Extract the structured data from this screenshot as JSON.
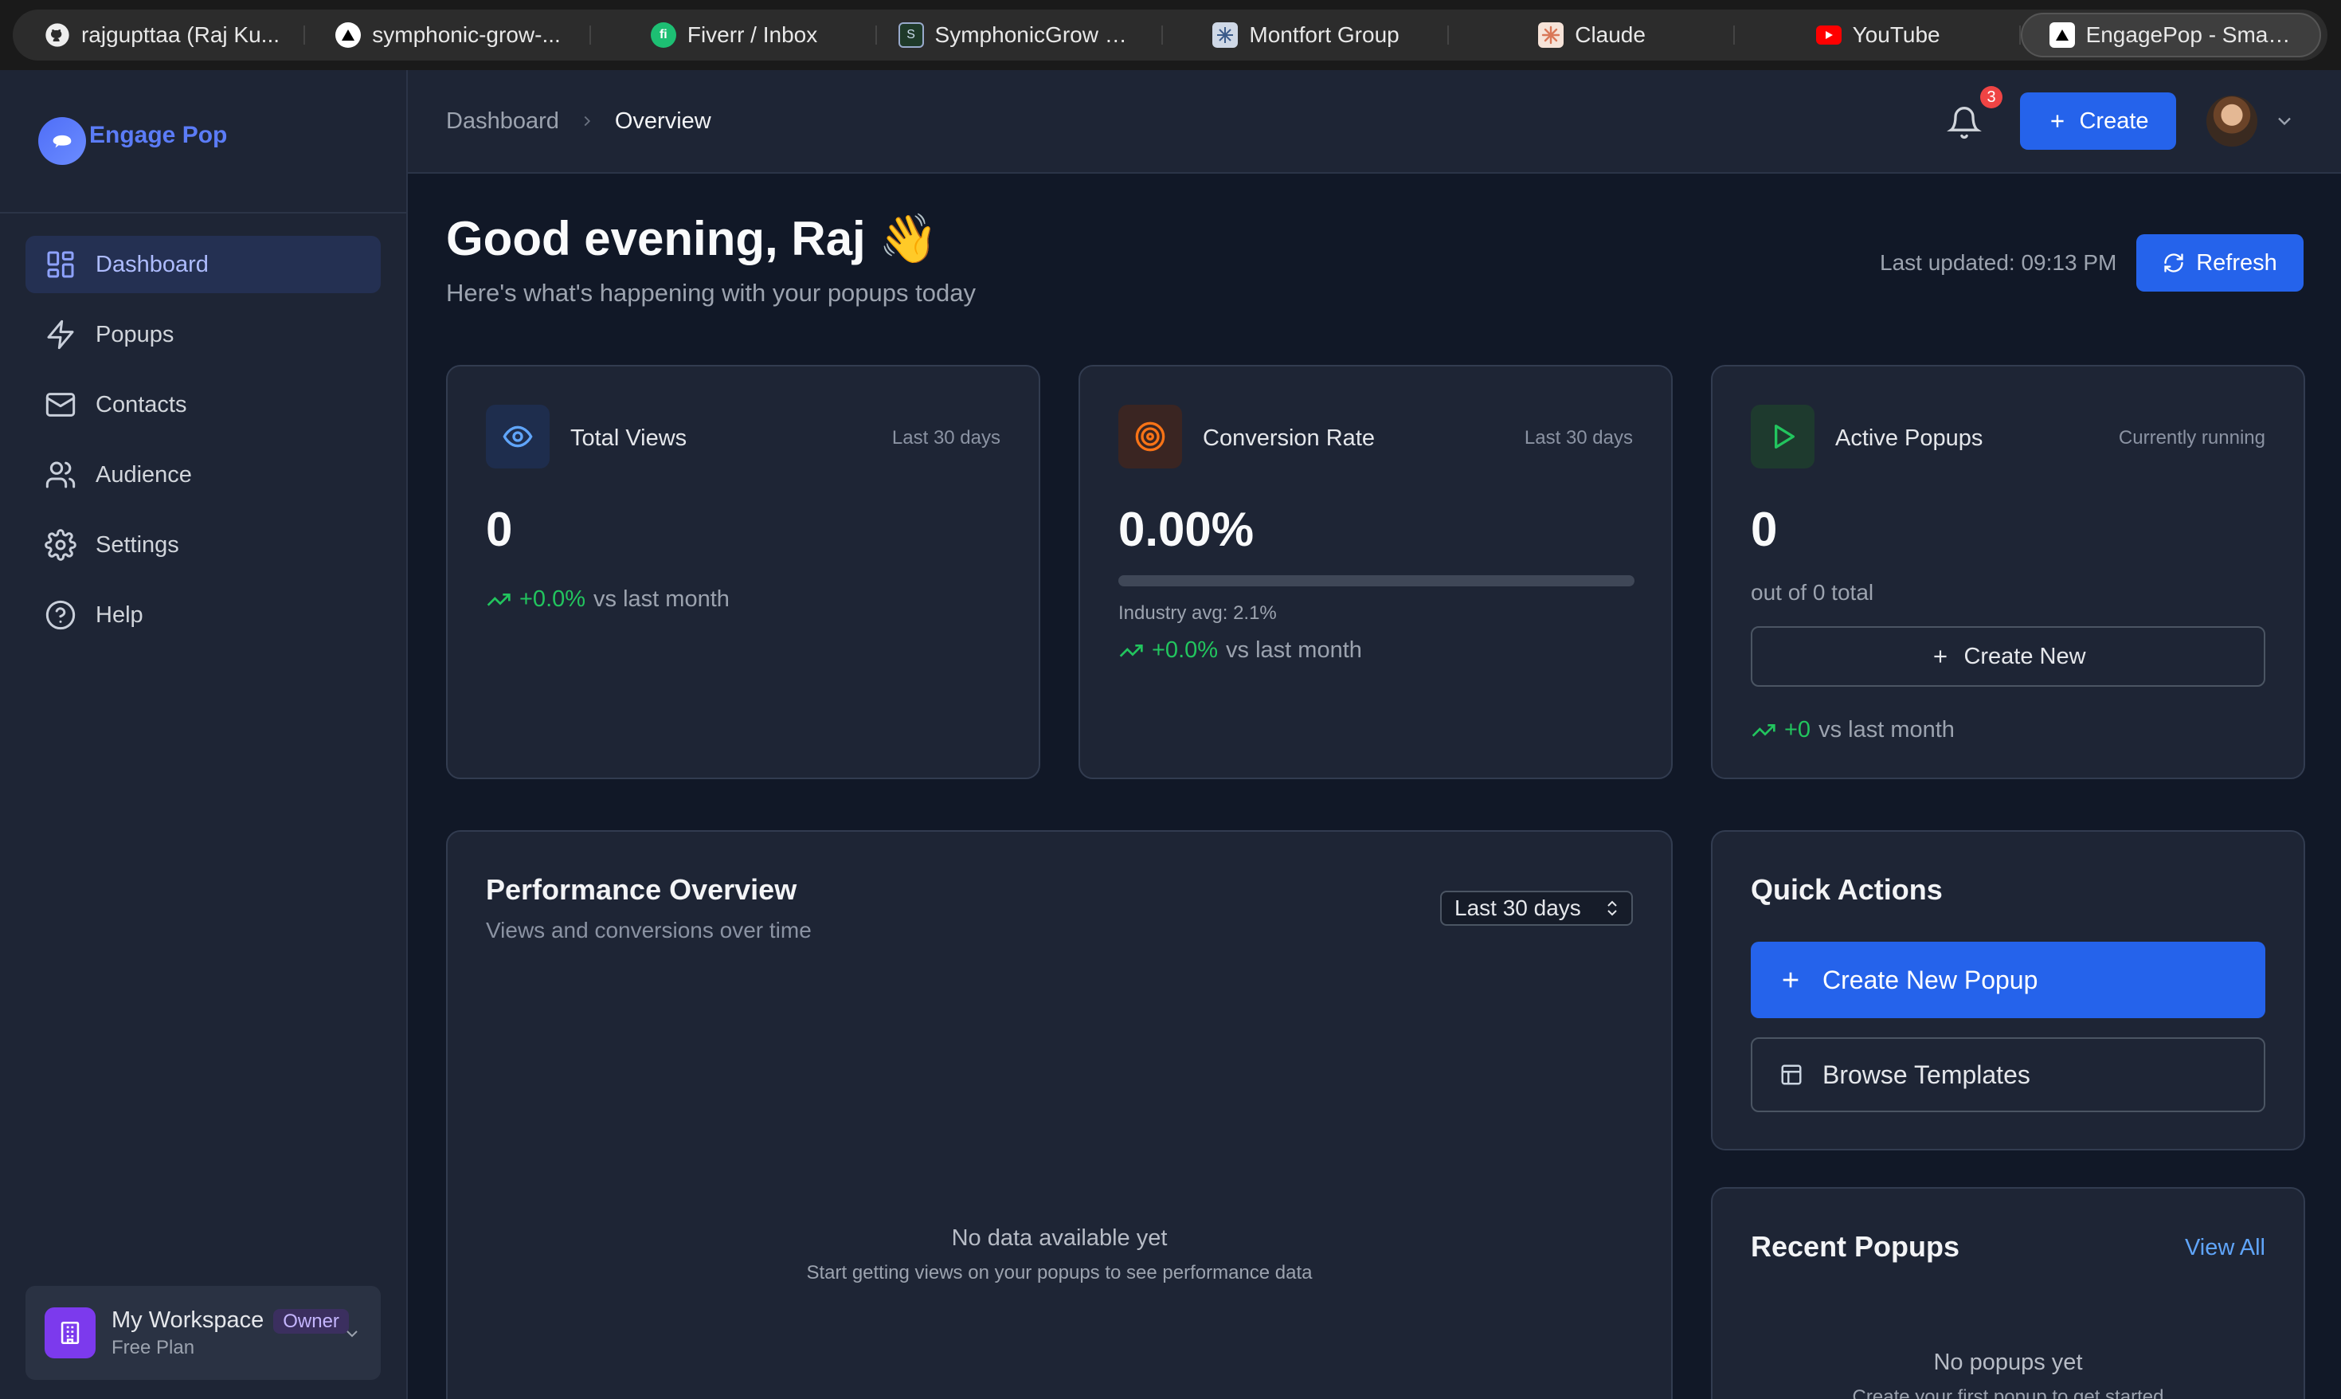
{
  "browser": {
    "tabs": [
      {
        "label": "rajgupttaa (Raj Ku...",
        "icon": "github-icon"
      },
      {
        "label": "symphonic-grow-...",
        "icon": "vercel-icon"
      },
      {
        "label": "Fiverr / Inbox",
        "icon": "fiverr-icon"
      },
      {
        "label": "SymphonicGrow —...",
        "icon": "symphonicgrow-icon"
      },
      {
        "label": "Montfort Group",
        "icon": "montfort-icon"
      },
      {
        "label": "Claude",
        "icon": "claude-icon"
      },
      {
        "label": "YouTube",
        "icon": "youtube-icon"
      },
      {
        "label": "EngagePop - Smart...",
        "icon": "engagepop-icon",
        "active": true
      }
    ]
  },
  "sidebar": {
    "brand": "Engage Pop",
    "items": [
      {
        "label": "Dashboard",
        "icon": "dashboard-icon",
        "active": true
      },
      {
        "label": "Popups",
        "icon": "bolt-icon"
      },
      {
        "label": "Contacts",
        "icon": "mail-icon"
      },
      {
        "label": "Audience",
        "icon": "users-icon"
      },
      {
        "label": "Settings",
        "icon": "gear-icon"
      },
      {
        "label": "Help",
        "icon": "help-icon"
      }
    ],
    "workspace": {
      "name": "My Workspace",
      "badge": "Owner",
      "plan": "Free Plan"
    }
  },
  "header": {
    "breadcrumb": [
      "Dashboard",
      "Overview"
    ],
    "notifications": "3",
    "create_label": "Create"
  },
  "main": {
    "greeting": "Good evening, Raj 👋",
    "subtitle": "Here's what's happening with your popups today",
    "last_updated": "Last updated: 09:13 PM",
    "refresh_label": "Refresh",
    "stats": {
      "views": {
        "title": "Total Views",
        "period": "Last 30 days",
        "value": "0",
        "trend": "+0.0%",
        "trend_suffix": "vs last month"
      },
      "conversion": {
        "title": "Conversion Rate",
        "period": "Last 30 days",
        "value": "0.00%",
        "progress_fraction": 0.0,
        "industry": "Industry avg: 2.1%",
        "trend": "+0.0%",
        "trend_suffix": "vs last month"
      },
      "active": {
        "title": "Active Popups",
        "period": "Currently running",
        "value": "0",
        "out_of": "out of 0 total",
        "create_label": "Create New",
        "trend": "+0",
        "trend_suffix": "vs last month"
      }
    },
    "performance": {
      "title": "Performance Overview",
      "subtitle": "Views and conversions over time",
      "range": "Last 30 days",
      "empty_title": "No data available yet",
      "empty_sub": "Start getting views on your popups to see performance data"
    },
    "quick_actions": {
      "title": "Quick Actions",
      "create_popup": "Create New Popup",
      "browse_templates": "Browse Templates"
    },
    "recent": {
      "title": "Recent Popups",
      "view_all": "View All",
      "empty_title": "No popups yet",
      "empty_sub": "Create your first popup to get started"
    }
  },
  "colors": {
    "accent": "#2563eb",
    "positive": "#22c55e",
    "brand": "#5b7cf7"
  }
}
